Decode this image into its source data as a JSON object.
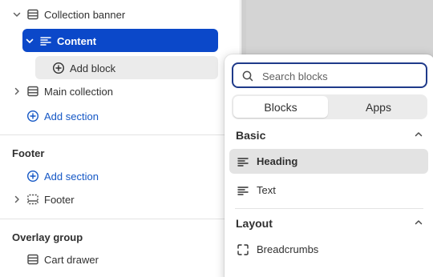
{
  "sidebar": {
    "template_sections": [
      {
        "label": "Collection banner"
      },
      {
        "label": "Content"
      },
      {
        "label": "Add block"
      },
      {
        "label": "Main collection"
      },
      {
        "label": "Add section"
      }
    ],
    "footer_group": {
      "title": "Footer",
      "add_label": "Add section",
      "item_label": "Footer"
    },
    "overlay_group": {
      "title": "Overlay group",
      "item_label": "Cart drawer"
    }
  },
  "popover": {
    "search_placeholder": "Search blocks",
    "tabs": [
      {
        "label": "Blocks",
        "active": true
      },
      {
        "label": "Apps",
        "active": false
      }
    ],
    "groups": [
      {
        "title": "Basic",
        "items": [
          {
            "label": "Heading",
            "icon": "text-lines-icon"
          },
          {
            "label": "Text",
            "icon": "text-lines-icon"
          }
        ]
      },
      {
        "title": "Layout",
        "items": [
          {
            "label": "Breadcrumbs",
            "icon": "frame-corners-icon"
          }
        ]
      }
    ]
  },
  "colors": {
    "accent": "#0b48c9",
    "link": "#1457c5"
  }
}
